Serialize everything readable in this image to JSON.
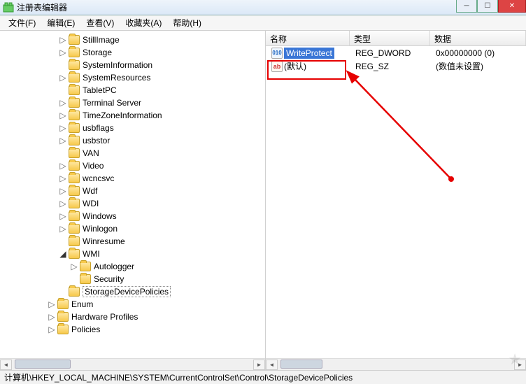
{
  "window": {
    "title": "注册表编辑器"
  },
  "menu": {
    "file": "文件(F)",
    "edit": "编辑(E)",
    "view": "查看(V)",
    "favorites": "收藏夹(A)",
    "help": "帮助(H)"
  },
  "columns": {
    "name": "名称",
    "type": "类型",
    "data": "数据"
  },
  "values": [
    {
      "icon": "str",
      "name": "(默认)",
      "type": "REG_SZ",
      "data": "(数值未设置)",
      "selected": false
    },
    {
      "icon": "dword",
      "name": "WriteProtect",
      "type": "REG_DWORD",
      "data": "0x00000000 (0)",
      "selected": true
    }
  ],
  "tree": [
    {
      "indent": 5,
      "expander": "open",
      "label": "StillImage"
    },
    {
      "indent": 5,
      "expander": "open",
      "label": "Storage"
    },
    {
      "indent": 5,
      "expander": "none",
      "label": "SystemInformation"
    },
    {
      "indent": 5,
      "expander": "open",
      "label": "SystemResources"
    },
    {
      "indent": 5,
      "expander": "none",
      "label": "TabletPC"
    },
    {
      "indent": 5,
      "expander": "open",
      "label": "Terminal Server"
    },
    {
      "indent": 5,
      "expander": "open",
      "label": "TimeZoneInformation"
    },
    {
      "indent": 5,
      "expander": "open",
      "label": "usbflags"
    },
    {
      "indent": 5,
      "expander": "open",
      "label": "usbstor"
    },
    {
      "indent": 5,
      "expander": "none",
      "label": "VAN"
    },
    {
      "indent": 5,
      "expander": "open",
      "label": "Video"
    },
    {
      "indent": 5,
      "expander": "open",
      "label": "wcncsvc"
    },
    {
      "indent": 5,
      "expander": "open",
      "label": "Wdf"
    },
    {
      "indent": 5,
      "expander": "open",
      "label": "WDI"
    },
    {
      "indent": 5,
      "expander": "open",
      "label": "Windows"
    },
    {
      "indent": 5,
      "expander": "open",
      "label": "Winlogon"
    },
    {
      "indent": 5,
      "expander": "none",
      "label": "Winresume"
    },
    {
      "indent": 5,
      "expander": "collapsed",
      "label": "WMI"
    },
    {
      "indent": 6,
      "expander": "open",
      "label": "Autologger"
    },
    {
      "indent": 6,
      "expander": "none",
      "label": "Security"
    },
    {
      "indent": 5,
      "expander": "none",
      "label": "StorageDevicePolicies",
      "selected": true
    },
    {
      "indent": 4,
      "expander": "open",
      "label": "Enum"
    },
    {
      "indent": 4,
      "expander": "open",
      "label": "Hardware Profiles"
    },
    {
      "indent": 4,
      "expander": "open",
      "label": "Policies"
    }
  ],
  "statusbar": {
    "path": "计算机\\HKEY_LOCAL_MACHINE\\SYSTEM\\CurrentControlSet\\Control\\StorageDevicePolicies"
  },
  "icon_text": {
    "str": "ab",
    "dword": "010"
  }
}
